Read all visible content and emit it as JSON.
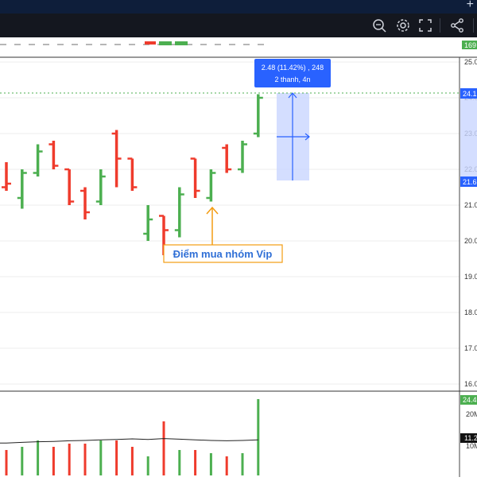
{
  "toolbar": {
    "icons": [
      "zoom-search-icon",
      "settings-icon",
      "fullscreen-icon",
      "share-icon"
    ]
  },
  "price_axis": {
    "ticks": [
      "25.0",
      "24.0",
      "23.0",
      "22.0",
      "21.0",
      "20.0",
      "19.0",
      "18.0",
      "17.0",
      "16.0"
    ],
    "tags": [
      {
        "text": "24.1",
        "color": "#2962ff"
      },
      {
        "text": "21.6",
        "color": "#2962ff"
      }
    ]
  },
  "top_strip_label": "169",
  "measure": {
    "line1": "2.48 (11.42%) , 248",
    "line2": "2 thanh, 4n"
  },
  "annotation": "Điểm mua nhóm Vip",
  "volume_axis": {
    "ticks": [
      "20M",
      "10M"
    ],
    "last_volume_tag": "24.4",
    "ma_tag": "11.2"
  },
  "colors": {
    "up": "#4caf50",
    "down": "#ef3b2c",
    "accent": "#2962ff",
    "annotation": "#f39c12",
    "measure_fill": "#c9d6ff"
  },
  "chart_data": {
    "type": "ohlc-bar",
    "ylim": [
      16,
      25
    ],
    "bars": [
      {
        "o": 21.5,
        "h": 22.2,
        "l": 21.4,
        "c": 21.6,
        "dir": "down"
      },
      {
        "o": 21.2,
        "h": 22.0,
        "l": 20.9,
        "c": 21.9,
        "dir": "up"
      },
      {
        "o": 21.9,
        "h": 22.7,
        "l": 21.8,
        "c": 22.5,
        "dir": "up"
      },
      {
        "o": 22.7,
        "h": 22.8,
        "l": 22.0,
        "c": 22.1,
        "dir": "down"
      },
      {
        "o": 22.0,
        "h": 22.0,
        "l": 21.0,
        "c": 21.1,
        "dir": "down"
      },
      {
        "o": 21.4,
        "h": 21.5,
        "l": 20.6,
        "c": 20.8,
        "dir": "down"
      },
      {
        "o": 21.1,
        "h": 22.0,
        "l": 21.0,
        "c": 21.8,
        "dir": "up"
      },
      {
        "o": 23.0,
        "h": 23.1,
        "l": 21.5,
        "c": 22.3,
        "dir": "down"
      },
      {
        "o": 22.3,
        "h": 22.3,
        "l": 21.4,
        "c": 21.5,
        "dir": "down"
      },
      {
        "o": 20.2,
        "h": 21.0,
        "l": 20.0,
        "c": 20.6,
        "dir": "up"
      },
      {
        "o": 20.7,
        "h": 20.7,
        "l": 19.6,
        "c": 20.3,
        "dir": "down"
      },
      {
        "o": 20.3,
        "h": 21.5,
        "l": 20.1,
        "c": 21.3,
        "dir": "up"
      },
      {
        "o": 22.3,
        "h": 22.3,
        "l": 21.2,
        "c": 21.4,
        "dir": "down"
      },
      {
        "o": 21.2,
        "h": 22.0,
        "l": 21.1,
        "c": 21.9,
        "dir": "up"
      },
      {
        "o": 22.6,
        "h": 22.7,
        "l": 21.9,
        "c": 22.0,
        "dir": "down"
      },
      {
        "o": 22.0,
        "h": 22.8,
        "l": 21.9,
        "c": 22.7,
        "dir": "up"
      },
      {
        "o": 23.0,
        "h": 24.1,
        "l": 22.9,
        "c": 24.0,
        "dir": "up"
      }
    ],
    "volume": {
      "ylim": [
        0,
        25
      ],
      "values": [
        8,
        9,
        11,
        9,
        10,
        10,
        11,
        11,
        9,
        6,
        17,
        8,
        8,
        7,
        6,
        7,
        24
      ],
      "ma": [
        10.2,
        10.4,
        10.6,
        10.7,
        10.9,
        11.0,
        11.2,
        11.3,
        11.5,
        11.3,
        11.6,
        11.4,
        11.2,
        11.0,
        10.9,
        11.0,
        11.2
      ]
    }
  }
}
